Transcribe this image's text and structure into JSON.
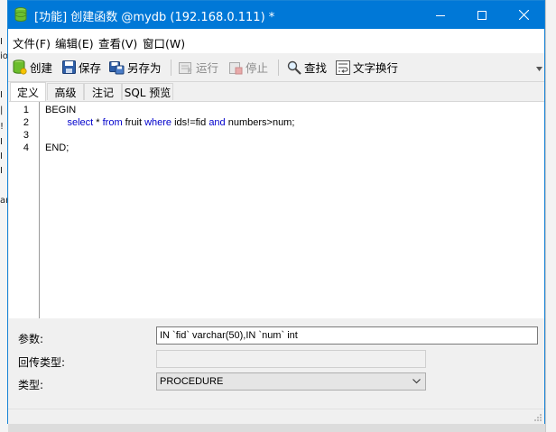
{
  "window": {
    "title": "[功能] 创建函数 @mydb (192.168.0.111) *"
  },
  "menu": {
    "file": "文件(F)",
    "edit": "编辑(E)",
    "view": "查看(V)",
    "window": "窗口(W)"
  },
  "toolbar": {
    "create": "创建",
    "save": "保存",
    "save_as": "另存为",
    "run": "运行",
    "stop": "停止",
    "find": "查找",
    "word_wrap": "文字换行"
  },
  "tabs": {
    "definition": "定义",
    "advanced": "高级",
    "comment": "注记",
    "sql_preview": "SQL 预览"
  },
  "editor": {
    "line_numbers": [
      "1",
      "2",
      "3",
      "4"
    ],
    "line1": "BEGIN",
    "line2": {
      "indent": "        ",
      "select": "select",
      "star": " * ",
      "from": "from",
      "table": " fruit ",
      "where": "where",
      "cond": " ids!=fid ",
      "and": "and",
      "rest": " numbers>num;"
    },
    "line4": "END;"
  },
  "form": {
    "params_label": "参数:",
    "params_value": "IN `fid` varchar(50),IN `num` int",
    "return_label": "回传类型:",
    "return_value": "",
    "type_label": "类型:",
    "type_value": "PROCEDURE"
  },
  "colors": {
    "titlebar": "#0078d7",
    "keyword": "#0000cc"
  }
}
